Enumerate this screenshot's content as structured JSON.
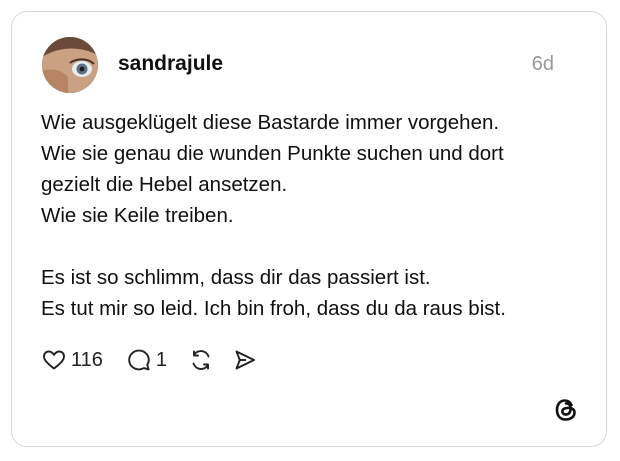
{
  "post": {
    "username": "sandrajule",
    "time": "6d",
    "paragraphs": [
      [
        "Wie ausgeklügelt diese Bastarde immer vorgehen.",
        "Wie sie genau die wunden Punkte suchen und dort",
        "gezielt die Hebel ansetzen.",
        "Wie sie Keile treiben."
      ],
      [
        "Es ist so schlimm, dass dir das passiert ist.",
        "Es tut mir so leid. Ich bin froh, dass du da raus bist."
      ]
    ]
  },
  "actions": {
    "like_count": "116",
    "reply_count": "1"
  },
  "icons": [
    "heart-icon",
    "comment-icon",
    "repost-icon",
    "share-icon",
    "threads-logo-icon"
  ]
}
